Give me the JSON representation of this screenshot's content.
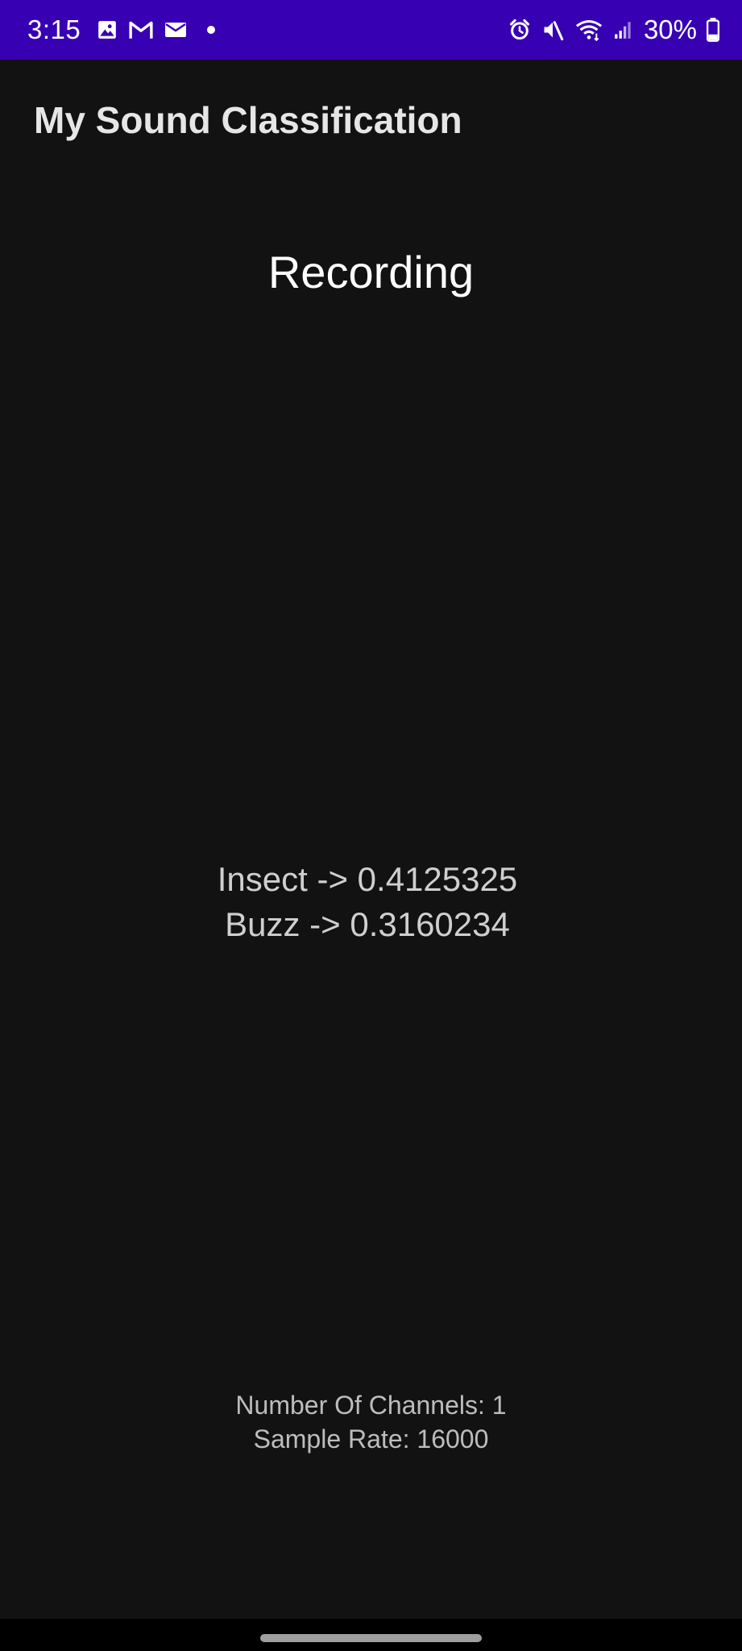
{
  "status_bar": {
    "time": "3:15",
    "battery": "30%",
    "left_icons": [
      "gallery-icon",
      "gmail-icon",
      "email-icon",
      "dot-icon"
    ],
    "right_icons": [
      "alarm-icon",
      "mute-icon",
      "wifi-icon",
      "signal-icon",
      "battery-icon"
    ],
    "background_color": "#3700b3"
  },
  "app_bar": {
    "title": "My Sound Classification"
  },
  "main": {
    "status_label": "Recording",
    "results": [
      "Insect -> 0.4125325",
      "Buzz -> 0.3160234"
    ],
    "audio_info": {
      "channels": "Number Of Channels: 1",
      "sample_rate": "Sample Rate: 16000"
    }
  },
  "theme": {
    "background": "#121212",
    "text_primary": "#ffffff",
    "text_secondary": "#cfcfcf"
  }
}
